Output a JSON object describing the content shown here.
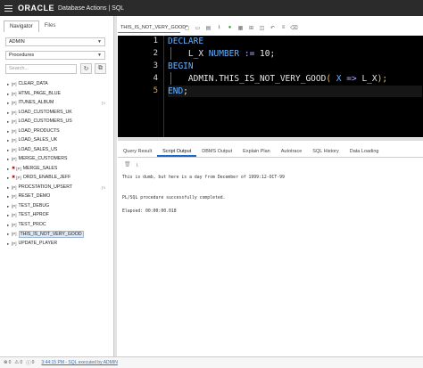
{
  "header": {
    "brand": "ORACLE",
    "app_title": "Database Actions | SQL"
  },
  "navigator": {
    "tabs": [
      {
        "label": "Navigator"
      },
      {
        "label": "Files"
      }
    ],
    "schema_select": "ADMIN",
    "object_type_select": "Procedures",
    "search_placeholder": "Search..."
  },
  "tree": [
    {
      "name": "CLEAR_DATA",
      "error": false,
      "fx": false
    },
    {
      "name": "HTML_PAGE_BLUE",
      "error": false,
      "fx": false
    },
    {
      "name": "ITUNES_ALBUM",
      "error": false,
      "fx": true
    },
    {
      "name": "LOAD_CUSTOMERS_UK",
      "error": false,
      "fx": false
    },
    {
      "name": "LOAD_CUSTOMERS_US",
      "error": false,
      "fx": false
    },
    {
      "name": "LOAD_PRODUCTS",
      "error": false,
      "fx": false
    },
    {
      "name": "LOAD_SALES_UK",
      "error": false,
      "fx": false
    },
    {
      "name": "LOAD_SALES_US",
      "error": false,
      "fx": false
    },
    {
      "name": "MERGE_CUSTOMERS",
      "error": false,
      "fx": false
    },
    {
      "name": "MERGE_SALES",
      "error": true,
      "fx": false
    },
    {
      "name": "ORDS_ENABLE_JEFF",
      "error": true,
      "fx": false
    },
    {
      "name": "PROCSTATION_UPSERT",
      "error": false,
      "fx": true
    },
    {
      "name": "RESET_DEMO",
      "error": false,
      "fx": false
    },
    {
      "name": "TEST_DEBUG",
      "error": false,
      "fx": false
    },
    {
      "name": "TEST_HPROF",
      "error": false,
      "fx": false
    },
    {
      "name": "TEST_PROC",
      "error": false,
      "fx": false
    },
    {
      "name": "THIS_IS_NOT_VERY_GOOD",
      "error": false,
      "fx": false,
      "selected": true
    },
    {
      "name": "UPDATE_PLAYER",
      "error": false,
      "fx": false
    }
  ],
  "tree_prefix": "[P]",
  "editor": {
    "tab_name": "THIS_IS_NOT_VERY_GOOD*",
    "line_numbers": [
      "1",
      "2",
      "3",
      "4",
      "5"
    ],
    "current_line": 5,
    "code": {
      "l1_kw": "DECLARE",
      "l2_var": "L_X",
      "l2_type": "NUMBER",
      "l2_op": ":=",
      "l2_val": "10",
      "l2_end": ";",
      "l3_kw": "BEGIN",
      "l4_call": "ADMIN.THIS_IS_NOT_VERY_GOOD",
      "l4_open": "(",
      "l4_param": "X",
      "l4_arrow": "=>",
      "l4_arg": "L_X",
      "l4_close": ");",
      "l5_kw": "END",
      "l5_end": ";"
    }
  },
  "output_tabs": [
    {
      "label": "Query Result"
    },
    {
      "label": "Script Output",
      "active": true
    },
    {
      "label": "DBMS Output"
    },
    {
      "label": "Explain Plan"
    },
    {
      "label": "Autotrace"
    },
    {
      "label": "SQL History"
    },
    {
      "label": "Data Loading"
    }
  ],
  "output_lines": [
    "This is dumb, but here is a day from December of 1999:12-OCT-99",
    "",
    "",
    "PL/SQL procedure successfully completed.",
    "",
    "Elapsed: 00:00:00.018"
  ],
  "status": {
    "count1": "0",
    "count2": "0",
    "count3": "0",
    "message": "3:44:15 PM - SQL executed by ADMIN"
  },
  "colors": {
    "keyword": "#66b3ff",
    "active_tab": "#1b6ac9",
    "editor_bg": "#000000"
  }
}
